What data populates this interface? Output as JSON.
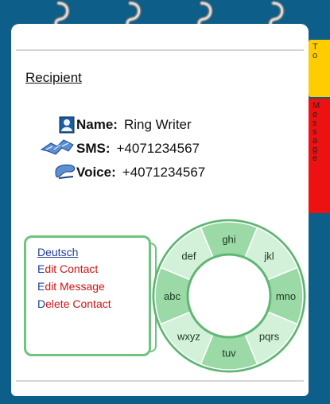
{
  "window": {
    "frame_color": "#0d5f8a",
    "accent_green": "#6cc47f"
  },
  "tabs": [
    {
      "text": "T\no",
      "color": "#ffcc00"
    },
    {
      "text": "M\ne\ns\ns\na\ng\ne",
      "color": "#ee1111"
    }
  ],
  "recipient": {
    "heading": "Recipient",
    "name": {
      "label": "Name:",
      "value": "Ring Writer",
      "icon": "contact-card-icon"
    },
    "sms": {
      "label": "SMS:",
      "value": "+4071234567",
      "icon": "sms-icon"
    },
    "voice": {
      "label": "Voice:",
      "value": "+4071234567",
      "icon": "phone-handset-icon"
    }
  },
  "menu": {
    "language": "Deutsch",
    "edit_contact": {
      "first": "E",
      "rest": "dit Contact"
    },
    "edit_message": {
      "first": "E",
      "rest": "dit Message"
    },
    "delete_contact": {
      "first": "D",
      "rest": "elete Contact"
    }
  },
  "keypad": {
    "keys": [
      "ghi",
      "jkl",
      "mno",
      "pqrs",
      "tuv",
      "wxyz",
      "abc",
      "def"
    ]
  }
}
